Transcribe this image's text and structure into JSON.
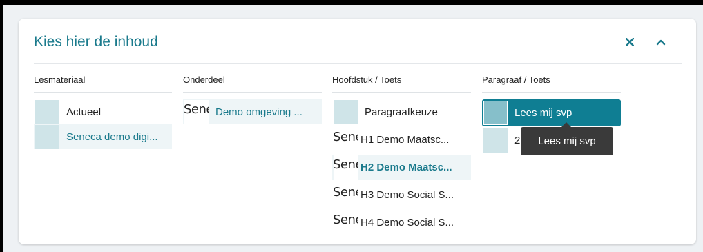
{
  "panel": {
    "title": "Kies hier de inhoud"
  },
  "columns": [
    {
      "header": "Lesmateriaal",
      "items": [
        {
          "label": "Actueel"
        },
        {
          "label": "Seneca demo digi..."
        }
      ]
    },
    {
      "header": "Onderdeel",
      "items": [
        {
          "label": "Demo omgeving ...",
          "logo": "Sene"
        }
      ]
    },
    {
      "header": "Hoofdstuk / Toets",
      "items": [
        {
          "label": "Paragraafkeuze"
        },
        {
          "label": "H1 Demo Maatsc...",
          "logo": "Sene"
        },
        {
          "label": "H2 Demo Maatsc...",
          "logo": "Sene"
        },
        {
          "label": "H3 Demo Social S...",
          "logo": "Sene"
        },
        {
          "label": "H4 Demo Social S...",
          "logo": "Sene"
        }
      ]
    },
    {
      "header": "Paragraaf / Toets",
      "items": [
        {
          "label": "Lees mij svp"
        },
        {
          "label": "2.1 ..."
        }
      ]
    }
  ],
  "tooltip": {
    "text": "Lees mij svp"
  }
}
